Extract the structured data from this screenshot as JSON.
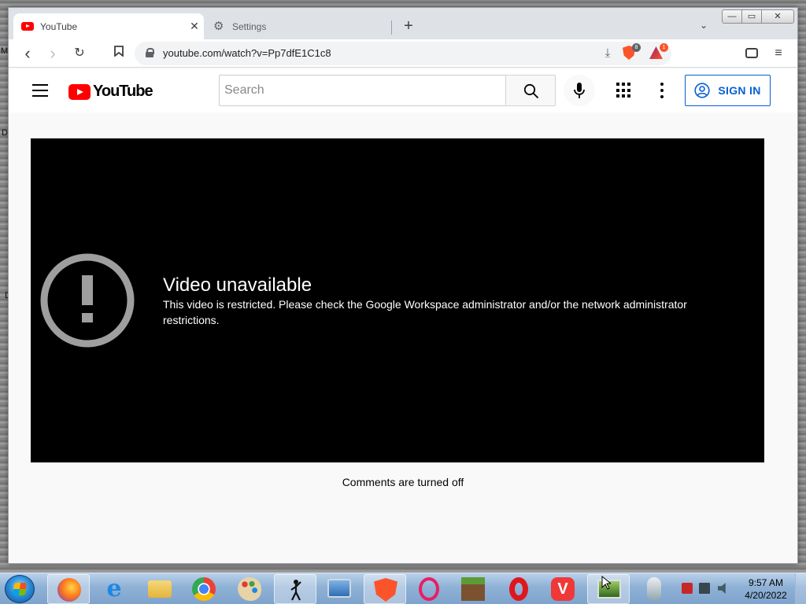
{
  "desktop": {
    "edge_letters": [
      "M",
      "D",
      "D"
    ]
  },
  "browser": {
    "tabs": [
      {
        "title": "YouTube",
        "active": true
      },
      {
        "title": "Settings",
        "active": false
      }
    ],
    "new_tab_symbol": "+",
    "tab_close_symbol": "✕",
    "tab_list_symbol": "⌄",
    "window_buttons": {
      "minimize": "—",
      "maximize": "▭",
      "close": "✕"
    },
    "url": "youtube.com/watch?v=Pp7dfE1C1c8",
    "brave_shield_count": "8",
    "brave_rewards_count": "1",
    "nav": {
      "back": "‹",
      "forward": "›",
      "reload": "↻",
      "bookmark": "⌑",
      "menu": "≡"
    }
  },
  "youtube": {
    "logo_text": "YouTube",
    "search_placeholder": "Search",
    "sign_in_label": "SIGN IN",
    "player": {
      "error_title": "Video unavailable",
      "error_message": "This video is restricted. Please check the Google Workspace administrator and/or the network administrator restrictions."
    },
    "comments_status": "Comments are turned off"
  },
  "taskbar": {
    "items": [
      "firefox-icon",
      "internet-explorer-icon",
      "file-explorer-icon",
      "chrome-icon",
      "paint-icon",
      "stick-figure-app-icon",
      "control-panel-icon",
      "brave-icon",
      "opera-gx-icon",
      "minecraft-icon",
      "opera-icon",
      "vivaldi-icon",
      "network-monitor-icon",
      "mouse-icon"
    ],
    "clock_time": "9:57 AM",
    "clock_date": "4/20/2022"
  },
  "colors": {
    "youtube_red": "#ff0000",
    "sign_in_blue": "#065fd4",
    "player_bg": "#000000",
    "brave_orange": "#fb542b"
  }
}
